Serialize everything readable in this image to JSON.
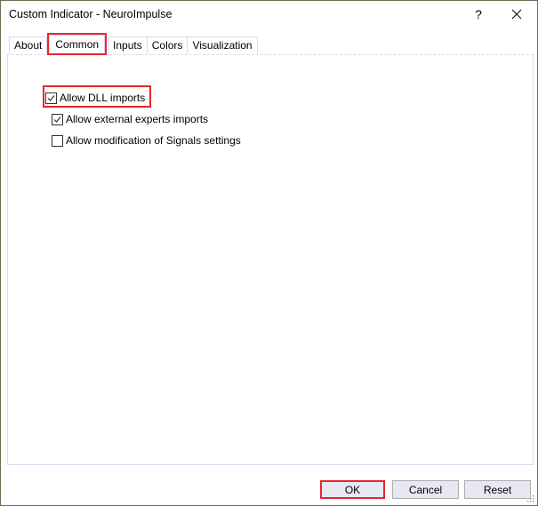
{
  "window": {
    "title": "Custom Indicator - NeuroImpulse",
    "help_label": "?",
    "close_icon": "close-icon"
  },
  "tabs": [
    {
      "label": "About",
      "active": false
    },
    {
      "label": "Common",
      "active": true
    },
    {
      "label": "Inputs",
      "active": false
    },
    {
      "label": "Colors",
      "active": false
    },
    {
      "label": "Visualization",
      "active": false
    }
  ],
  "options": [
    {
      "label": "Allow DLL imports",
      "checked": true,
      "highlighted": true
    },
    {
      "label": "Allow external experts imports",
      "checked": true,
      "highlighted": false
    },
    {
      "label": "Allow modification of Signals settings",
      "checked": false,
      "highlighted": false
    }
  ],
  "buttons": {
    "ok": "OK",
    "cancel": "Cancel",
    "reset": "Reset"
  },
  "colors": {
    "highlight": "#e8262a",
    "button_face": "#e8e8f5",
    "tab_border": "#d9d9f0"
  }
}
